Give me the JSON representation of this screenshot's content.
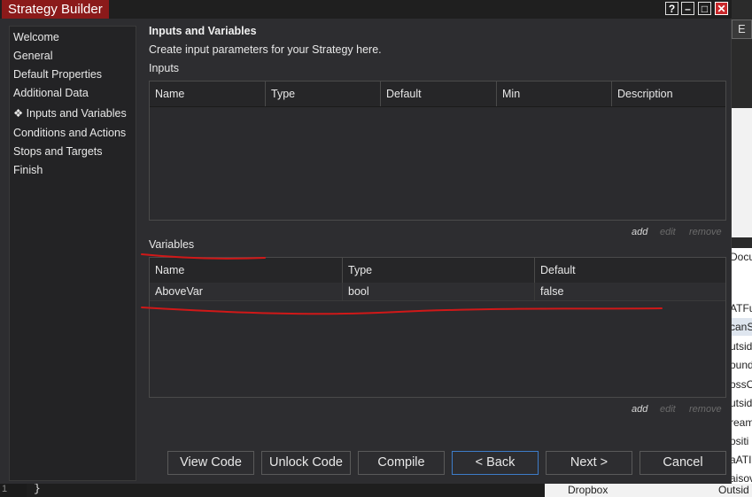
{
  "window": {
    "title": "Strategy Builder",
    "controls": {
      "help": "?",
      "minimize": "–",
      "maximize": "□",
      "close": "✕"
    }
  },
  "background": {
    "tab_label": "E",
    "list_items": [
      "ATFu",
      "canSu",
      "utsid",
      "ound",
      "ossO",
      "utsid",
      "ream",
      "ositi",
      "aATI",
      "aisova"
    ],
    "doc_label": "Docu",
    "dropbox_label": "Dropbox",
    "outside_label": "Outsid",
    "brace": "}",
    "line_number": "1"
  },
  "nav": {
    "items": [
      {
        "label": "Welcome"
      },
      {
        "label": "General"
      },
      {
        "label": "Default Properties"
      },
      {
        "label": "Additional Data"
      },
      {
        "label": "❖ Inputs and Variables"
      },
      {
        "label": "Conditions and Actions"
      },
      {
        "label": "Stops and Targets"
      },
      {
        "label": "Finish"
      }
    ]
  },
  "main": {
    "heading": "Inputs and Variables",
    "description": "Create input parameters for your Strategy here.",
    "inputs": {
      "label": "Inputs",
      "columns": [
        "Name",
        "Type",
        "Default",
        "Min",
        "Description"
      ],
      "rows": [],
      "actions": {
        "add": "add",
        "edit": "edit",
        "remove": "remove"
      }
    },
    "variables": {
      "label": "Variables",
      "columns": [
        "Name",
        "Type",
        "Default"
      ],
      "rows": [
        {
          "name": "AboveVar",
          "type": "bool",
          "default": "false"
        }
      ],
      "actions": {
        "add": "add",
        "edit": "edit",
        "remove": "remove"
      }
    }
  },
  "footer": {
    "buttons": [
      "View Code",
      "Unlock Code",
      "Compile",
      "< Back",
      "Next >",
      "Cancel"
    ]
  },
  "colors": {
    "title_accent": "#8b1a1a",
    "annotation": "#d01818",
    "focus_border": "#3d7cc9"
  }
}
